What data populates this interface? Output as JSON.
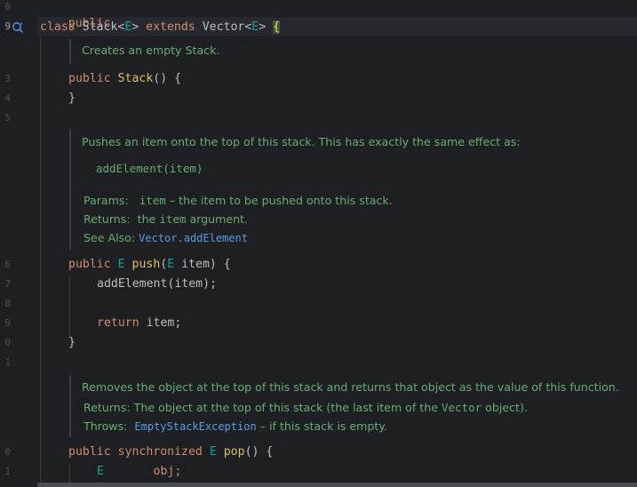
{
  "gutter": {
    "line_numbers": [
      "8",
      "9",
      "3",
      "4",
      "5",
      "6",
      "7",
      "8",
      "9",
      "0",
      "1",
      "0",
      "1"
    ],
    "active_line": "9"
  },
  "code": {
    "l1": "public",
    "l2_class": "class",
    "l2_name": "Stack",
    "l2_gen_open": "<",
    "l2_gen": "E",
    "l2_gen_close": ">",
    "l2_extends": "extends",
    "l2_super": "Vector",
    "l2_brace": "{",
    "ctor_public": "public",
    "ctor_name": "Stack",
    "ctor_parens": "()",
    "ctor_open": "{",
    "ctor_close": "}",
    "push_public": "public",
    "push_type": "E",
    "push_name": "push",
    "push_param_type": "E",
    "push_param": "item",
    "push_brace": "{",
    "push_body1_fn": "addElement",
    "push_body1_arg": "item",
    "push_return": "return",
    "push_return_val": "item;",
    "push_close": "}",
    "pop_public": "public",
    "pop_sync": "synchronized",
    "pop_type": "E",
    "pop_name": "pop",
    "pop_parens": "()",
    "pop_brace": "{",
    "pop_body_type": "E",
    "pop_body_var": "obj;"
  },
  "docs": {
    "ctor": {
      "text": "Creates an empty Stack."
    },
    "push": {
      "summary": "Pushes an item onto the top of this stack. This has exactly the same effect as:",
      "example": "addElement(item)",
      "params_label": "Params:",
      "params_name": "item",
      "params_desc": "– the item to be pushed onto this stack.",
      "returns_label": "Returns:",
      "returns_pre": "the",
      "returns_code": "item",
      "returns_post": "argument.",
      "see_label": "See Also:",
      "see_ref": "Vector.addElement"
    },
    "pop": {
      "summary": "Removes the object at the top of this stack and returns that object as the value of this function.",
      "returns_label": "Returns:",
      "returns_text_pre": "The object at the top of this stack (the last item of the",
      "returns_code": "Vector",
      "returns_text_post": "object).",
      "throws_label": "Throws:",
      "throws_ref": "EmptyStackException",
      "throws_desc": "– if this stack is empty."
    }
  },
  "colors": {
    "background": "#1e1f22",
    "keyword": "#cf8e6d",
    "doc_text": "#6aab73",
    "link": "#5c9de3"
  },
  "icons": {
    "gutter_icon": "override-method-icon"
  }
}
